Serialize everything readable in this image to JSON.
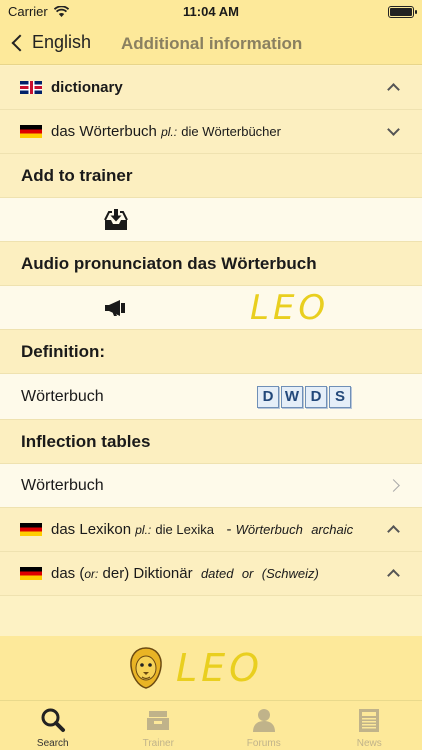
{
  "status_bar": {
    "carrier": "Carrier",
    "time": "11:04 AM",
    "battery_level": 1.0
  },
  "nav": {
    "back_label": "English",
    "title": "Additional information"
  },
  "entries": {
    "dictionary": {
      "text": "dictionary"
    },
    "woerterbuch": {
      "text": "das Wörterbuch",
      "pl_label": "pl.:",
      "plural": "die Wörterbücher"
    },
    "lexikon": {
      "text": "das Lexikon",
      "pl_label": "pl.:",
      "plural": "die Lexika",
      "dash": "-",
      "ref": "Wörterbuch",
      "note": "archaic"
    },
    "diktionaer": {
      "pre": "das",
      "paren_open": "(",
      "or_label": "or:",
      "alt": "der)",
      "text": "Diktionär",
      "note1": "dated",
      "or2": "or",
      "note2": "(Schweiz)"
    }
  },
  "sections": {
    "add_trainer": "Add to trainer",
    "audio": "Audio pronunciaton das Wörterbuch",
    "definition": "Definition:",
    "inflection": "Inflection tables"
  },
  "definition_word": "Wörterbuch",
  "inflection_word": "Wörterbuch",
  "leo_logo": "LEO",
  "dwds_letters": [
    "D",
    "W",
    "D",
    "S"
  ],
  "tabs": [
    {
      "label": "Search",
      "icon": "search-icon",
      "active": true
    },
    {
      "label": "Trainer",
      "icon": "tray-icon",
      "active": false
    },
    {
      "label": "Forums",
      "icon": "person-icon",
      "active": false
    },
    {
      "label": "News",
      "icon": "newspaper-icon",
      "active": false
    }
  ],
  "colors": {
    "accent_yellow": "#e9cf1f",
    "bar": "#fde99a",
    "background": "#fdf2c4"
  }
}
